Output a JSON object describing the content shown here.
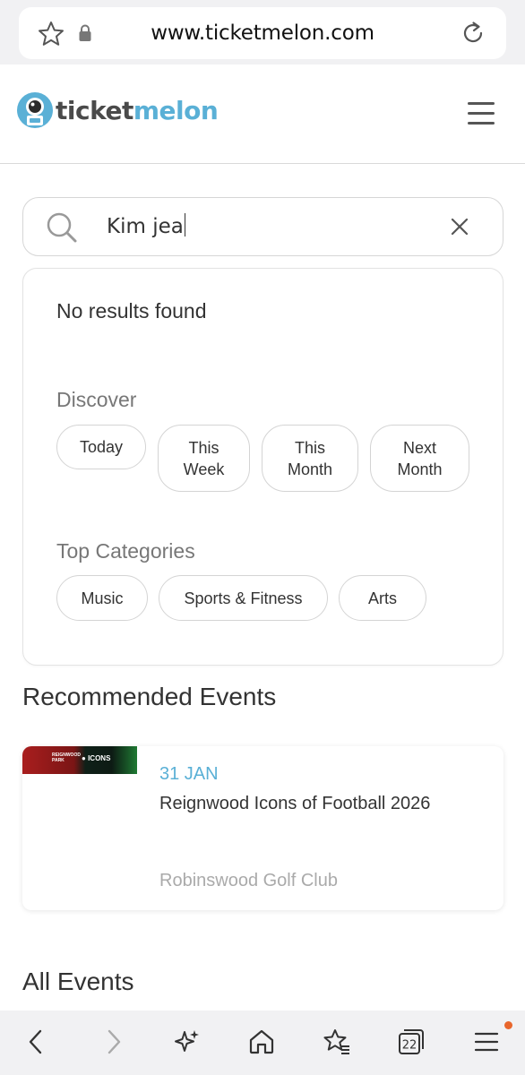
{
  "browser": {
    "url": "www.ticketmelon.com",
    "tabs_count": "22"
  },
  "site": {
    "logo_text_dark": "ticket",
    "logo_text_light": "melon"
  },
  "search": {
    "value": "Kim jea"
  },
  "dropdown": {
    "no_results": "No results found",
    "discover_label": "Discover",
    "discover_chips": [
      "Today",
      "This\nWeek",
      "This\nMonth",
      "Next\nMonth"
    ],
    "categories_label": "Top Categories",
    "category_chips": [
      "Music",
      "Sports & Fitness",
      "Arts"
    ]
  },
  "recommended": {
    "heading": "Recommended Events",
    "events": [
      {
        "date": "31 JAN",
        "title": "Reignwood Icons of Football 2026",
        "venue": "Robinswood Golf Club",
        "thumb_left": "REIGNWOOD PARK",
        "thumb_right": "ICONS"
      }
    ]
  },
  "all_events": {
    "heading": "All Events"
  },
  "colors": {
    "accent": "#5ab0d6",
    "notification": "#e8662c"
  }
}
